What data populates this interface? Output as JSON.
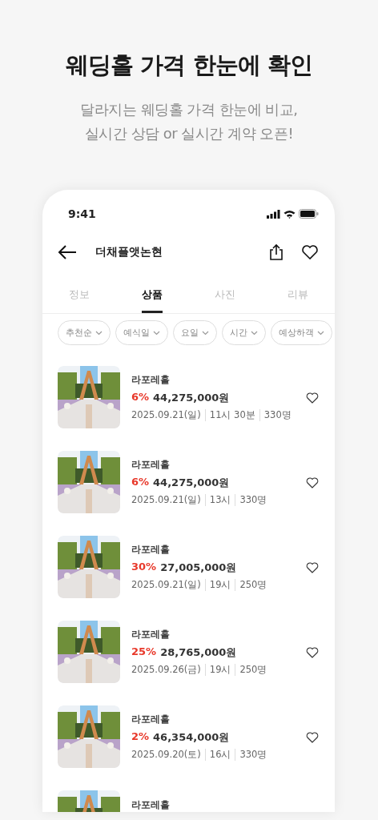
{
  "headline": "웨딩홀 가격 한눈에 확인",
  "subtitle": [
    "달라지는 웨딩홀 가격 한눈에 비교,",
    "실시간 상담 or 실시간 계약 오픈!"
  ],
  "status_bar": {
    "time": "9:41"
  },
  "header": {
    "title": "더채플앳논현",
    "liked": false
  },
  "tabs": [
    {
      "label": "정보",
      "selected": false
    },
    {
      "label": "상품",
      "selected": true
    },
    {
      "label": "사진",
      "selected": false
    },
    {
      "label": "리뷰",
      "selected": false
    }
  ],
  "filters": [
    "추천순",
    "예식일",
    "요일",
    "시간",
    "예상하객"
  ],
  "products": [
    {
      "name": "라포레홀",
      "discount": "6%",
      "price": "44,275,000원",
      "meta": [
        "2025.09.21(일)",
        "11시 30분",
        "330명"
      ],
      "liked": false
    },
    {
      "name": "라포레홀",
      "discount": "6%",
      "price": "44,275,000원",
      "meta": [
        "2025.09.21(일)",
        "13시",
        "330명"
      ],
      "liked": false
    },
    {
      "name": "라포레홀",
      "discount": "30%",
      "price": "27,005,000원",
      "meta": [
        "2025.09.21(일)",
        "19시",
        "250명"
      ],
      "liked": false
    },
    {
      "name": "라포레홀",
      "discount": "25%",
      "price": "28,765,000원",
      "meta": [
        "2025.09.26(금)",
        "19시",
        "250명"
      ],
      "liked": false
    },
    {
      "name": "라포레홀",
      "discount": "2%",
      "price": "46,354,000원",
      "meta": [
        "2025.09.20(토)",
        "16시",
        "330명"
      ],
      "liked": false
    },
    {
      "name": "라포레홀"
    }
  ]
}
